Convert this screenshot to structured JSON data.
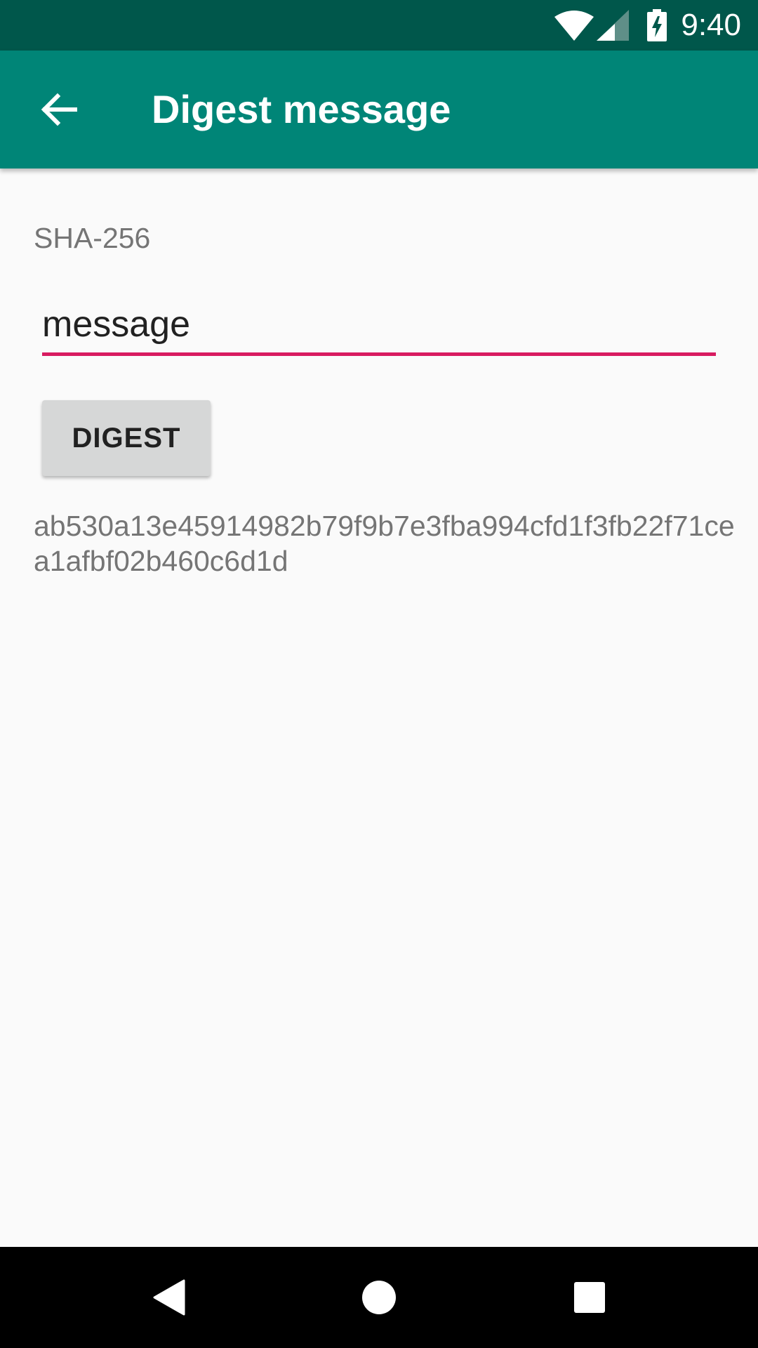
{
  "status_bar": {
    "time": "9:40",
    "icons": [
      "wifi-icon",
      "cell-signal-icon",
      "battery-charging-icon"
    ],
    "background": "#00574b"
  },
  "app_bar": {
    "title": "Digest message",
    "back_icon": "arrow-back-icon",
    "background": "#008577"
  },
  "content": {
    "algorithm": "SHA-256",
    "message_value": "message",
    "button_label": "DIGEST",
    "digest_result": "ab530a13e45914982b79f9b7e3fba994cfd1f3fb22f71cea1afbf02b460c6d1d",
    "accent": "#d81b60"
  },
  "nav_bar": {
    "icons": [
      "back-triangle-icon",
      "home-circle-icon",
      "recents-square-icon"
    ]
  }
}
